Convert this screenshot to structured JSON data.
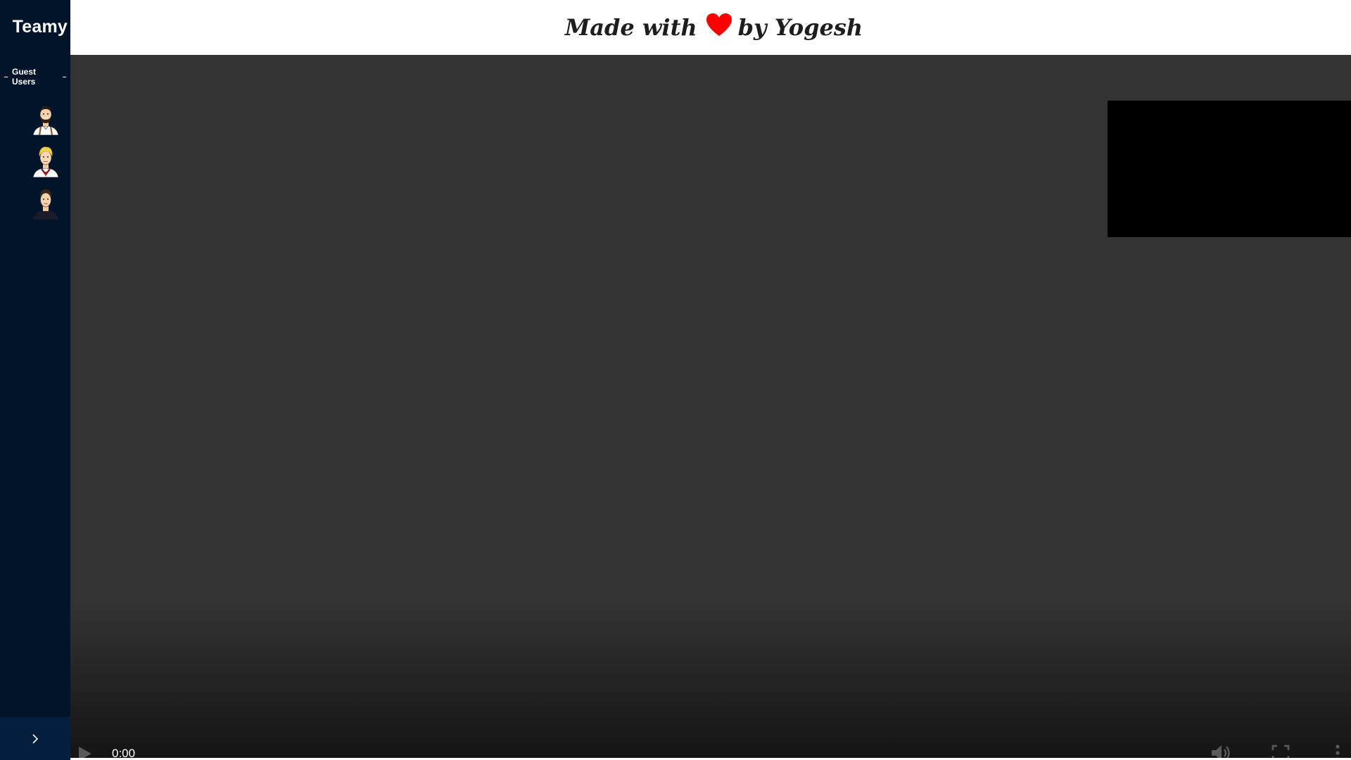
{
  "sidebar": {
    "brand": "Teamy",
    "section_title": "Guest Users",
    "users": [
      {
        "icon": "bearded-man-avatar-icon"
      },
      {
        "icon": "blonde-man-avatar-icon"
      },
      {
        "icon": "dark-hair-man-avatar-icon"
      }
    ],
    "toggle_icon": "chevron-right-icon"
  },
  "header": {
    "credit_prefix": "Made with",
    "credit_suffix": "by Yogesh",
    "heart_icon": "heart-icon",
    "heart_color": "#ff0000"
  },
  "video": {
    "time": "0:00",
    "background_color": "#333333",
    "self_view_color": "#000000",
    "controls": [
      "play-icon",
      "volume-icon",
      "fullscreen-icon",
      "more-vertical-icon"
    ]
  },
  "colors": {
    "sidebar_bg": "#02142a",
    "sidebar_toggle_bg": "#031f3d"
  }
}
